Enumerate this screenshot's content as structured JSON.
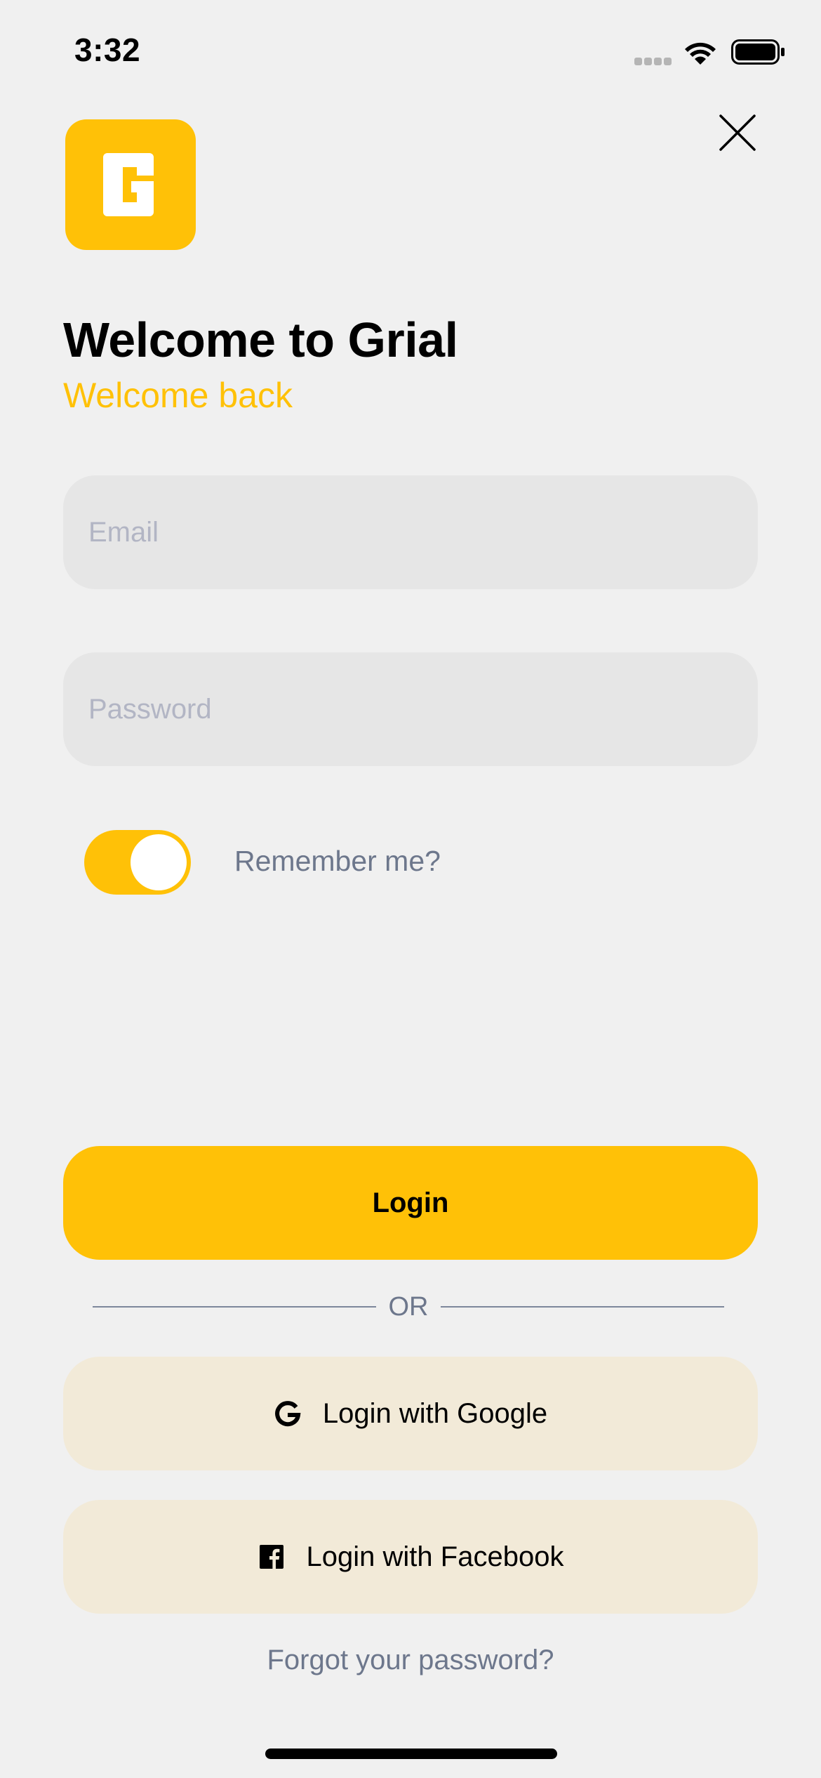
{
  "status_bar": {
    "time": "3:32"
  },
  "header": {
    "title": "Welcome to Grial",
    "subtitle": "Welcome back"
  },
  "form": {
    "email_placeholder": "Email",
    "password_placeholder": "Password",
    "remember_label": "Remember me?",
    "remember_on": true
  },
  "actions": {
    "login_label": "Login",
    "or_label": "OR",
    "google_label": "Login with Google",
    "facebook_label": "Login with Facebook",
    "forgot_label": "Forgot your password?"
  },
  "colors": {
    "accent": "#ffc107",
    "background": "#f0f0f0",
    "field_background": "#e6e6e6",
    "social_background": "#f2ead8",
    "muted_text": "#6d778c"
  },
  "icons": {
    "close": "close-icon",
    "logo": "grial-logo-icon",
    "google": "google-icon",
    "facebook": "facebook-icon"
  }
}
